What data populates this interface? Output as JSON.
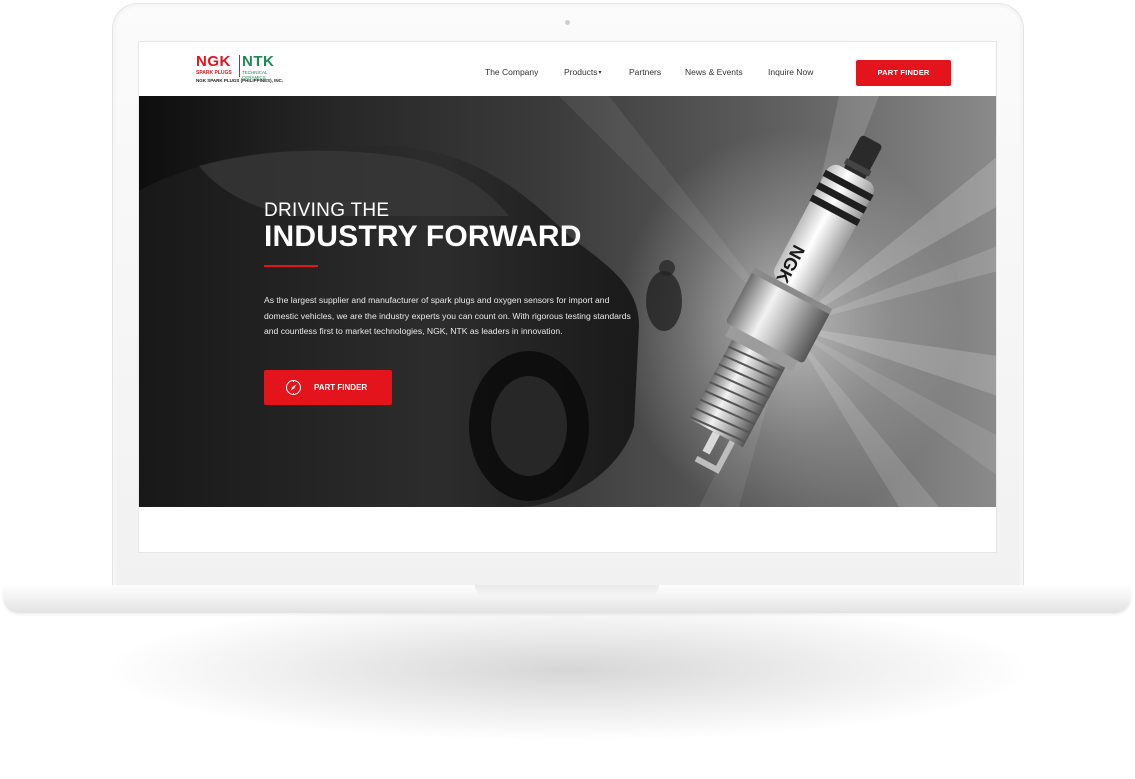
{
  "brand": {
    "ngk": "NGK",
    "ntk": "NTK",
    "ngk_sub": "SPARK PLUGS",
    "ntk_sub": "TECHNICAL CERAMICS",
    "company": "NGK SPARK PLUGS (PHILIPPINES), INC.",
    "colors": {
      "red": "#e3141c",
      "green": "#1d8a55"
    }
  },
  "nav": {
    "items": [
      {
        "label": "The Company"
      },
      {
        "label": "Products"
      },
      {
        "label": "Partners"
      },
      {
        "label": "News & Events"
      },
      {
        "label": "Inquire Now"
      }
    ],
    "products_caret": "▾",
    "cta": "PART FINDER"
  },
  "hero": {
    "headline_line1": "DRIVING THE",
    "headline_line2": "INDUSTRY FORWARD",
    "body": "As the largest supplier and manufacturer of spark plugs and oxygen sensors for import and domestic vehicles, we are the industry experts you can count on. With rigorous testing standards and countless first to market technologies, NGK, NTK as leaders in innovation.",
    "button_label": "PART FINDER",
    "button_icon": "compass-icon",
    "plug_marking": "NGK"
  }
}
